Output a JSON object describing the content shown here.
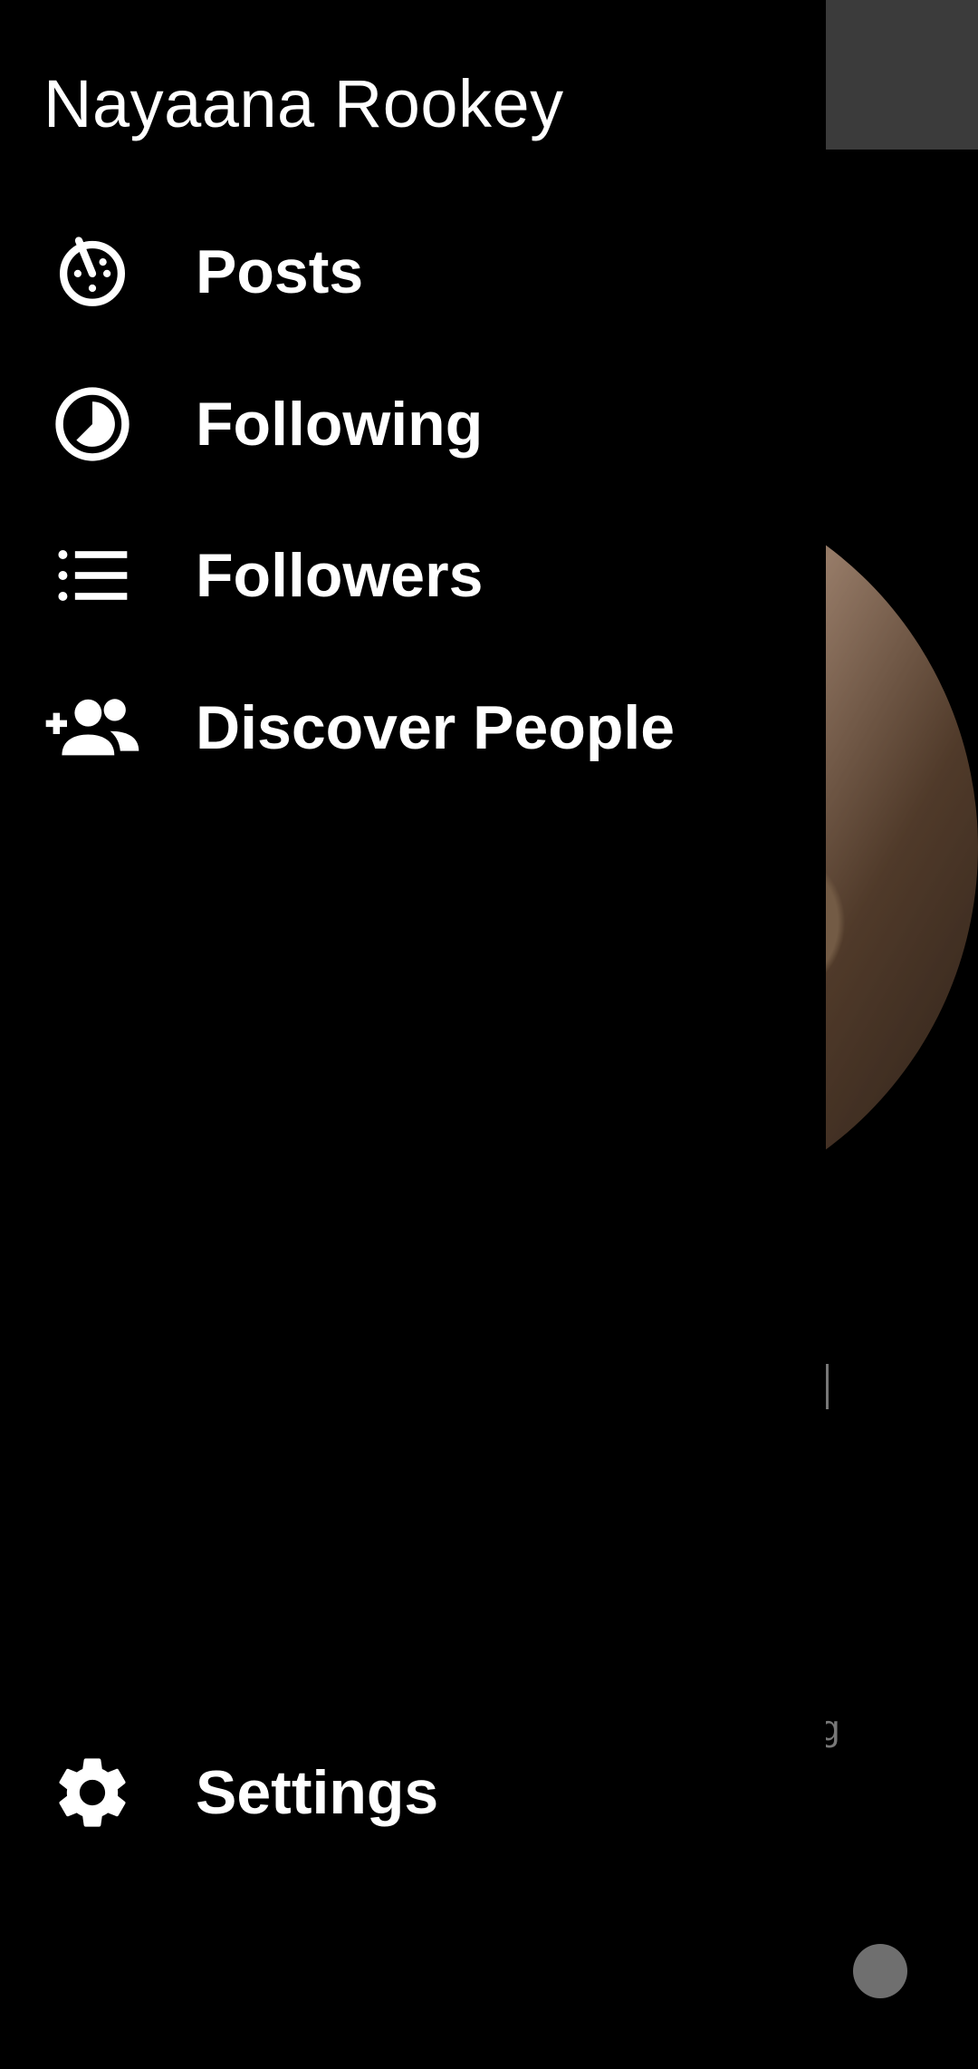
{
  "drawer": {
    "user_name": "Nayaana Rookey",
    "items": [
      {
        "label": "Posts",
        "icon": "timer-icon"
      },
      {
        "label": "Following",
        "icon": "pie-clock-icon"
      },
      {
        "label": "Followers",
        "icon": "list-icon"
      },
      {
        "label": "Discover People",
        "icon": "add-group-icon"
      }
    ],
    "settings": {
      "label": "Settings",
      "icon": "gear-icon"
    }
  },
  "underlay": {
    "peek_text": "g"
  },
  "colors": {
    "background": "#000000",
    "text": "#ffffff",
    "appbar_peek": "#3b3b3b",
    "fab_dimmed": "#6f6f6f"
  }
}
